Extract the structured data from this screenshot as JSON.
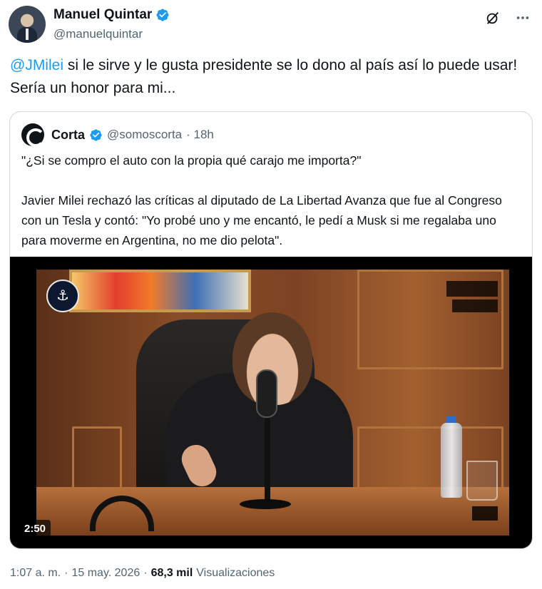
{
  "author": {
    "display_name": "Manuel Quintar",
    "handle": "@manuelquintar"
  },
  "tweet": {
    "mention": "@JMilei",
    "body": " si le sirve y le gusta presidente se lo dono al país así lo puede usar! Sería un honor para mi..."
  },
  "quoted": {
    "display_name": "Corta",
    "handle": "@somoscorta",
    "time": "· 18h",
    "text": "\"¿Si se compro el auto con la propia qué carajo me importa?\"\n\nJavier Milei rechazó las críticas al diputado de La Libertad Avanza que fue al Congreso con un Tesla y contó: \"Yo probé uno y me encantó, le pedí a Musk si me regalaba uno para moverme en Argentina, no me dio pelota\".",
    "video_duration": "2:50"
  },
  "meta": {
    "time": "1:07 a. m.",
    "sep1": "·",
    "date": "15 may. 2026",
    "sep2": "·",
    "views": "68,3 mil",
    "views_label": "Visualizaciones"
  },
  "icons": {
    "verified": "verified-badge-icon",
    "grok": "grok-icon",
    "more": "more-icon"
  },
  "colors": {
    "accent": "#1d9bf0",
    "text": "#0f1419",
    "secondary": "#536471",
    "border": "#cfd9de"
  }
}
